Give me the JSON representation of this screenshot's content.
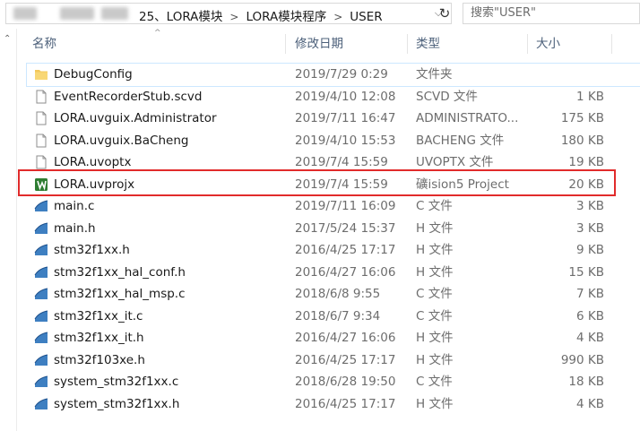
{
  "breadcrumb": {
    "items": [
      "25、LORA模块",
      "LORA模块程序",
      "USER"
    ]
  },
  "search": {
    "placeholder": "搜索\"USER\""
  },
  "columns": {
    "name": "名称",
    "date": "修改日期",
    "type": "类型",
    "size": "大小"
  },
  "files": [
    {
      "name": "DebugConfig",
      "date": "2019/7/29 0:29",
      "type": "文件夹",
      "size": "",
      "icon": "folder-icon"
    },
    {
      "name": "EventRecorderStub.scvd",
      "date": "2019/4/10 12:08",
      "type": "SCVD 文件",
      "size": "1 KB",
      "icon": "file-icon"
    },
    {
      "name": "LORA.uvguix.Administrator",
      "date": "2019/7/11 16:47",
      "type": "ADMINISTRATO...",
      "size": "175 KB",
      "icon": "file-icon"
    },
    {
      "name": "LORA.uvguix.BaCheng",
      "date": "2019/4/10 15:53",
      "type": "BACHENG 文件",
      "size": "180 KB",
      "icon": "file-icon"
    },
    {
      "name": "LORA.uvoptx",
      "date": "2019/7/4 15:59",
      "type": "UVOPTX 文件",
      "size": "19 KB",
      "icon": "file-icon"
    },
    {
      "name": "LORA.uvprojx",
      "date": "2019/7/4 15:59",
      "type": "礦ision5 Project",
      "size": "20 KB",
      "icon": "keil-project-icon"
    },
    {
      "name": "main.c",
      "date": "2019/7/11 16:09",
      "type": "C 文件",
      "size": "3 KB",
      "icon": "c-source-icon"
    },
    {
      "name": "main.h",
      "date": "2017/5/24 15:37",
      "type": "H 文件",
      "size": "3 KB",
      "icon": "c-source-icon"
    },
    {
      "name": "stm32f1xx.h",
      "date": "2016/4/25 17:17",
      "type": "H 文件",
      "size": "9 KB",
      "icon": "c-source-icon"
    },
    {
      "name": "stm32f1xx_hal_conf.h",
      "date": "2016/4/27 16:06",
      "type": "H 文件",
      "size": "15 KB",
      "icon": "c-source-icon"
    },
    {
      "name": "stm32f1xx_hal_msp.c",
      "date": "2018/6/8 9:55",
      "type": "C 文件",
      "size": "7 KB",
      "icon": "c-source-icon"
    },
    {
      "name": "stm32f1xx_it.c",
      "date": "2018/6/7 9:34",
      "type": "C 文件",
      "size": "6 KB",
      "icon": "c-source-icon"
    },
    {
      "name": "stm32f1xx_it.h",
      "date": "2016/4/27 16:06",
      "type": "H 文件",
      "size": "4 KB",
      "icon": "c-source-icon"
    },
    {
      "name": "stm32f103xe.h",
      "date": "2016/4/25 17:17",
      "type": "H 文件",
      "size": "990 KB",
      "icon": "c-source-icon"
    },
    {
      "name": "system_stm32f1xx.c",
      "date": "2018/6/28 19:50",
      "type": "C 文件",
      "size": "18 KB",
      "icon": "c-source-icon"
    },
    {
      "name": "system_stm32f1xx.h",
      "date": "2016/4/25 17:17",
      "type": "H 文件",
      "size": "4 KB",
      "icon": "c-source-icon"
    }
  ],
  "colors": {
    "highlight_frame": "#e12b2b",
    "header_text": "#4c607a",
    "hover_bg": "#e5f3ff"
  }
}
